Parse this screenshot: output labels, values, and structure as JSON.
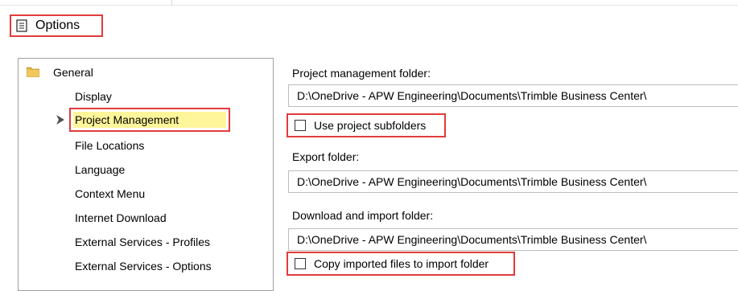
{
  "window": {
    "title": "Options",
    "icon": "options-document-icon"
  },
  "tree": {
    "root": {
      "label": "General",
      "icon": "folder-icon"
    },
    "items": [
      {
        "label": "Display"
      },
      {
        "label": "Project Management",
        "selected": true,
        "icon": "arrow-right-icon"
      },
      {
        "label": "File Locations"
      },
      {
        "label": "Language"
      },
      {
        "label": "Context Menu"
      },
      {
        "label": "Internet Download"
      },
      {
        "label": "External Services - Profiles"
      },
      {
        "label": "External Services - Options"
      }
    ]
  },
  "settings": {
    "project_folder": {
      "label": "Project management folder:",
      "value": "D:\\OneDrive - APW Engineering\\Documents\\Trimble Business Center\\"
    },
    "use_subfolders": {
      "label": "Use project subfolders",
      "checked": false
    },
    "export_folder": {
      "label": "Export folder:",
      "value": "D:\\OneDrive - APW Engineering\\Documents\\Trimble Business Center\\"
    },
    "download_folder": {
      "label": "Download and import folder:",
      "value": "D:\\OneDrive - APW Engineering\\Documents\\Trimble Business Center\\"
    },
    "copy_imported": {
      "label": "Copy imported files to import folder",
      "checked": false
    }
  },
  "colors": {
    "highlight_border": "#e23b3b",
    "selected_bg": "#fff59a",
    "folder": "#e8b94a"
  }
}
